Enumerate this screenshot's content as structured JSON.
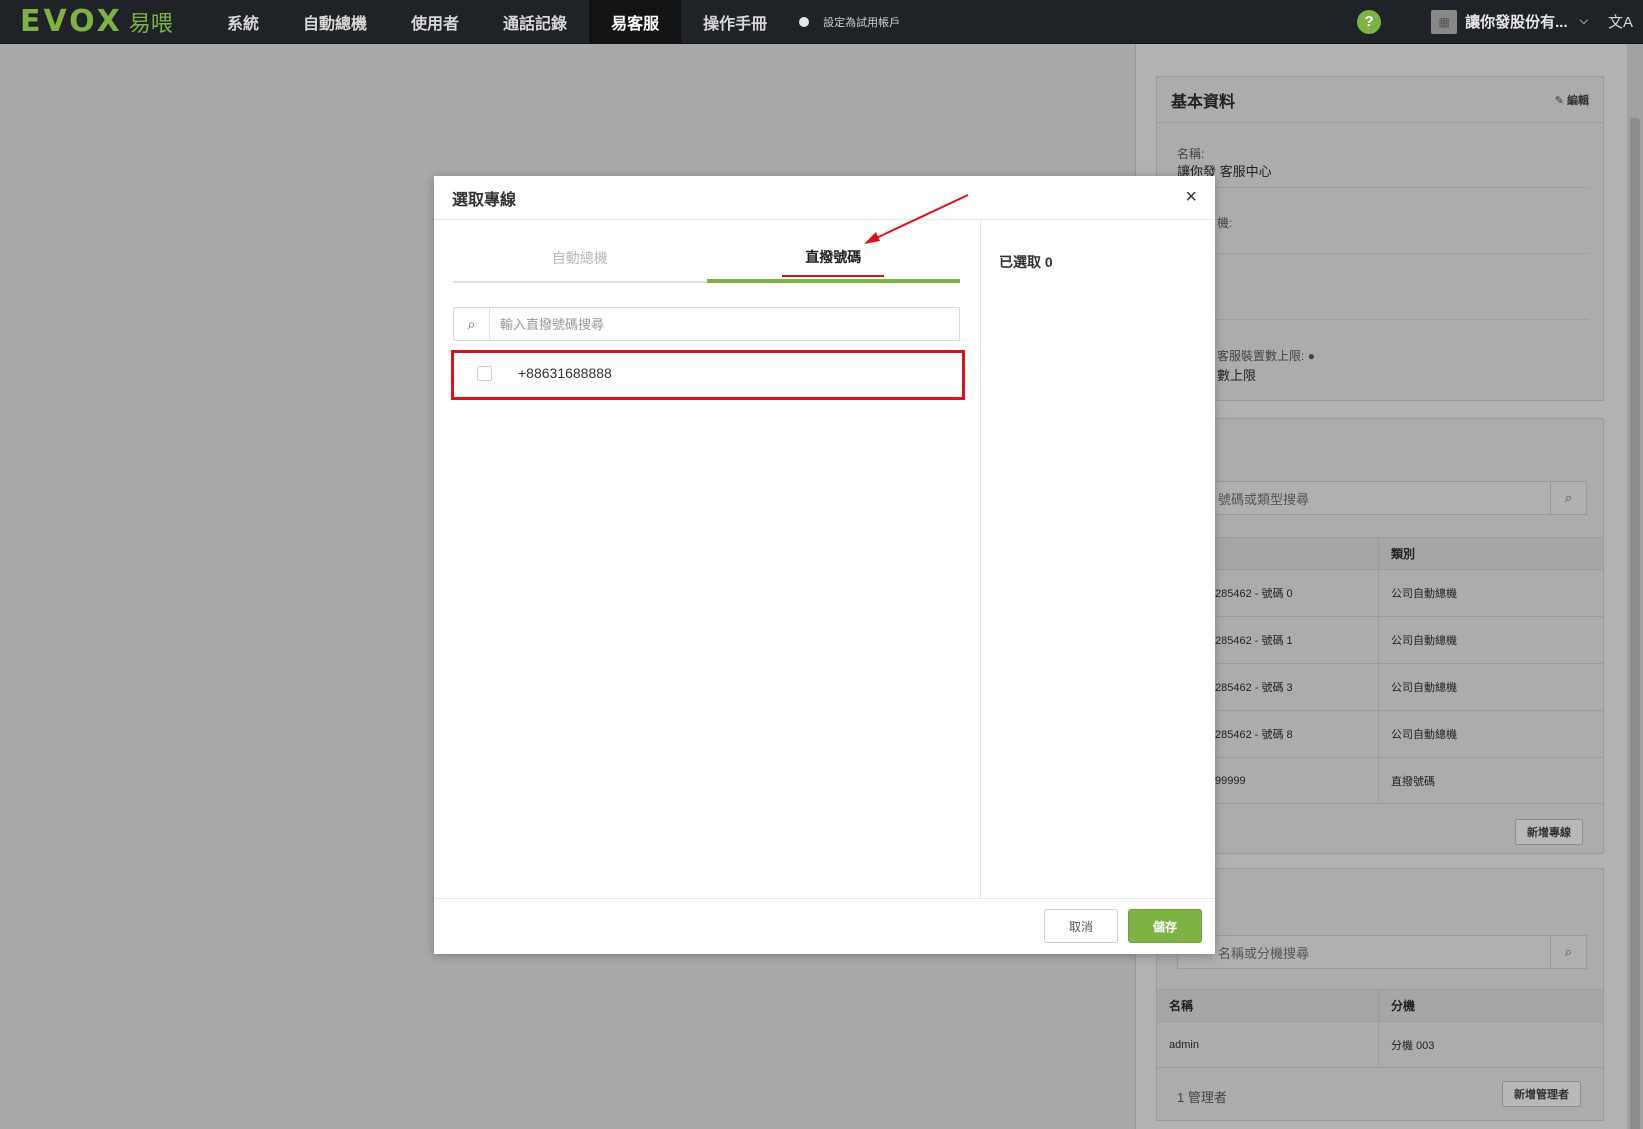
{
  "nav": {
    "logo_text": "EVOX",
    "logo_cn": "易喂",
    "items": [
      {
        "label": "系統"
      },
      {
        "label": "自動總機"
      },
      {
        "label": "使用者"
      },
      {
        "label": "通話記錄"
      },
      {
        "label": "易客服",
        "active": true
      },
      {
        "label": "操作手冊"
      }
    ],
    "trial_label": "設定為試用帳戶",
    "help": "?",
    "company": "讓你發股份有...",
    "lang_icon": "文A"
  },
  "panel": {
    "basic_title": "基本資料",
    "edit_label": "編輯",
    "name_label": "名稱:",
    "name_value": "讓你發 客服中心",
    "field2_label": "機:",
    "field3_label": "客服裝置數上限:",
    "field3_value": "數上限",
    "line_search_placeholder": "號碼或類型搜尋",
    "line_table": {
      "headers": [
        "",
        "類別"
      ],
      "rows": [
        [
          "285462 - 號碼 0",
          "公司自動總機"
        ],
        [
          "285462 - 號碼 1",
          "公司自動總機"
        ],
        [
          "285462 - 號碼 3",
          "公司自動總機"
        ],
        [
          "285462 - 號碼 8",
          "公司自動總機"
        ],
        [
          "99999",
          "直撥號碼"
        ]
      ]
    },
    "add_line_label": "新增專線",
    "admin_search_placeholder": "名稱或分機搜尋",
    "admin_table": {
      "headers": [
        "名稱",
        "分機"
      ],
      "rows": [
        [
          "admin",
          "分機 003"
        ]
      ]
    },
    "admin_count": "1 管理者",
    "add_admin_label": "新增管理者"
  },
  "modal": {
    "title": "選取專線",
    "close": "×",
    "tabs": [
      {
        "label": "自動總機"
      },
      {
        "label": "直撥號碼",
        "active": true
      }
    ],
    "search_placeholder": "輸入直撥號碼搜尋",
    "options": [
      {
        "label": "+88631688888",
        "checked": false
      }
    ],
    "selected_label": "已選取 0",
    "cancel_label": "取消",
    "save_label": "儲存"
  },
  "colors": {
    "brand": "#7cb342",
    "nav_bg": "#1f2226",
    "highlight": "#e0101a"
  }
}
